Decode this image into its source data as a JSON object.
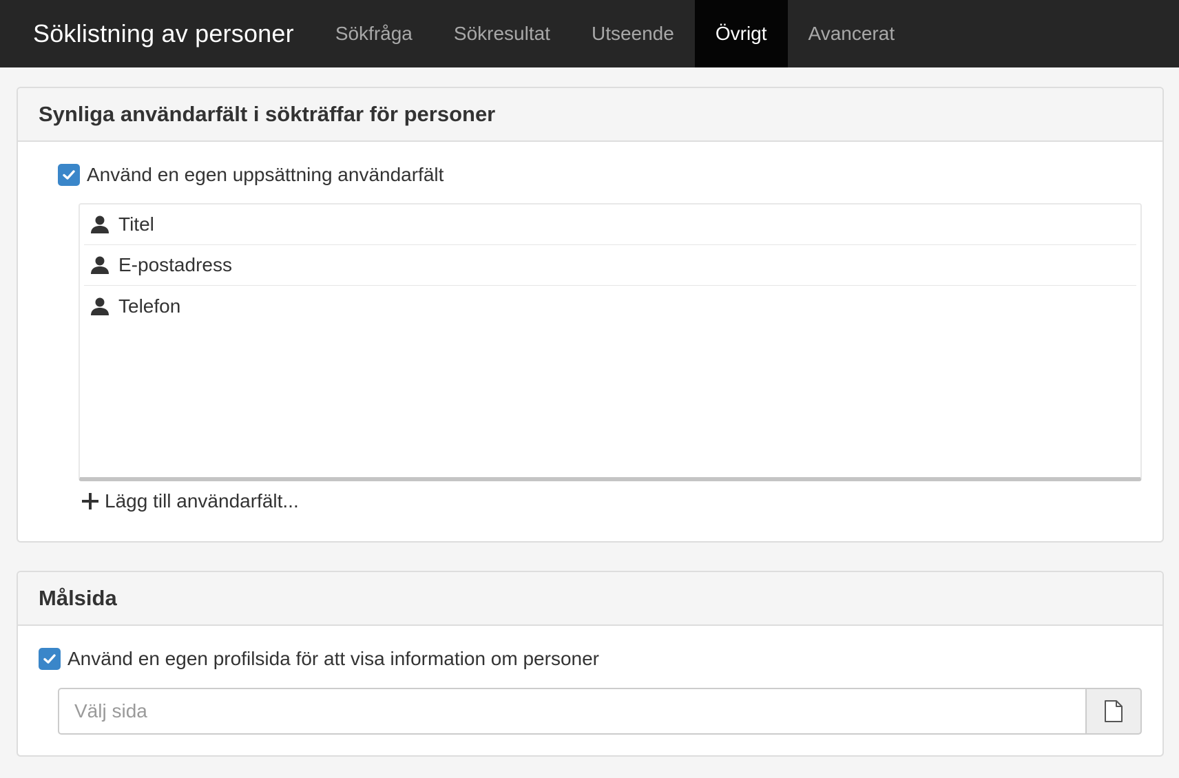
{
  "navbar": {
    "brand": "Söklistning av personer",
    "tabs": [
      {
        "label": "Sökfråga",
        "active": false
      },
      {
        "label": "Sökresultat",
        "active": false
      },
      {
        "label": "Utseende",
        "active": false
      },
      {
        "label": "Övrigt",
        "active": true
      },
      {
        "label": "Avancerat",
        "active": false
      }
    ]
  },
  "visible_fields_panel": {
    "title": "Synliga användarfält i sökträffar för personer",
    "custom_checkbox": {
      "label": "Använd en egen uppsättning användarfält",
      "checked": true
    },
    "fields": [
      {
        "label": "Titel",
        "icon": "user-icon"
      },
      {
        "label": "E-postadress",
        "icon": "user-icon"
      },
      {
        "label": "Telefon",
        "icon": "user-icon"
      }
    ],
    "add_link": "Lägg till användarfält..."
  },
  "target_page_panel": {
    "title": "Målsida",
    "profile_checkbox": {
      "label": "Använd en egen profilsida för att visa information om personer",
      "checked": true
    },
    "page_input": {
      "value": "",
      "placeholder": "Välj sida"
    },
    "page_picker_icon": "document-icon"
  },
  "colors": {
    "navbar_bg": "#262626",
    "active_tab_bg": "#050505",
    "checkbox_blue": "#3a86c9"
  }
}
